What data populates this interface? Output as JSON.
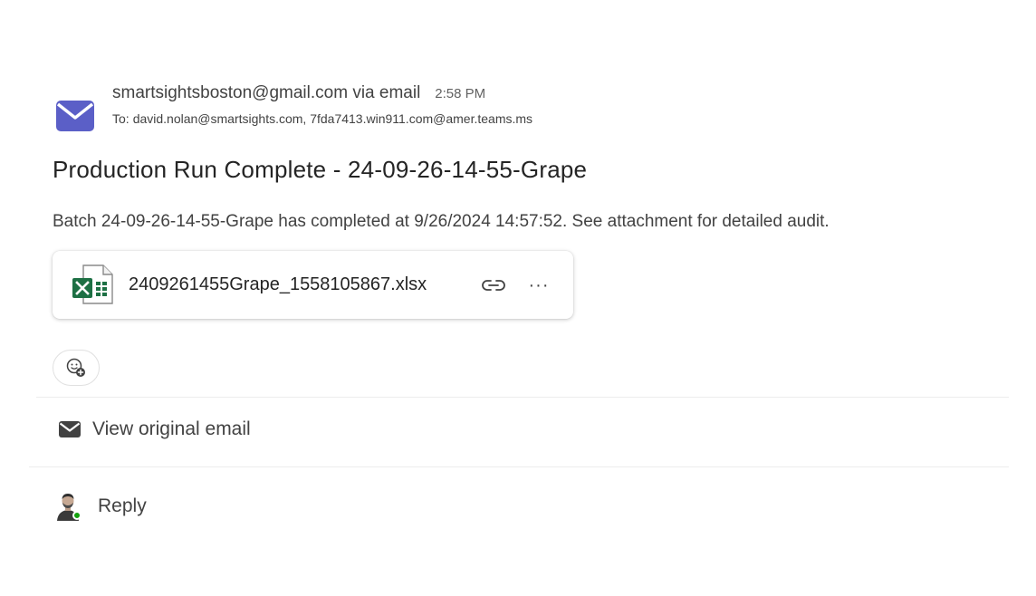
{
  "message": {
    "sender": "smartsightsboston@gmail.com via email",
    "time": "2:58 PM",
    "to_label": "To:",
    "recipients": "david.nolan@smartsights.com, 7fda7413.win911.com@amer.teams.ms",
    "subject": "Production Run Complete - 24-09-26-14-55-Grape",
    "body": "Batch 24-09-26-14-55-Grape has completed at 9/26/2024 14:57:52. See attachment for detailed audit."
  },
  "attachment": {
    "file_name": "2409261455Grape_1558105867.xlsx",
    "file_icon": "excel-file-icon",
    "link_icon": "link-icon",
    "more_label": "···"
  },
  "actions": {
    "reaction_icon": "add-reaction-icon",
    "view_original_label": "View original email",
    "view_original_icon": "mail-icon",
    "reply_label": "Reply",
    "presence_status": "available"
  },
  "colors": {
    "mail_icon": "#5b5fc7",
    "excel_green": "#1d7044",
    "presence_green": "#13a10e"
  }
}
